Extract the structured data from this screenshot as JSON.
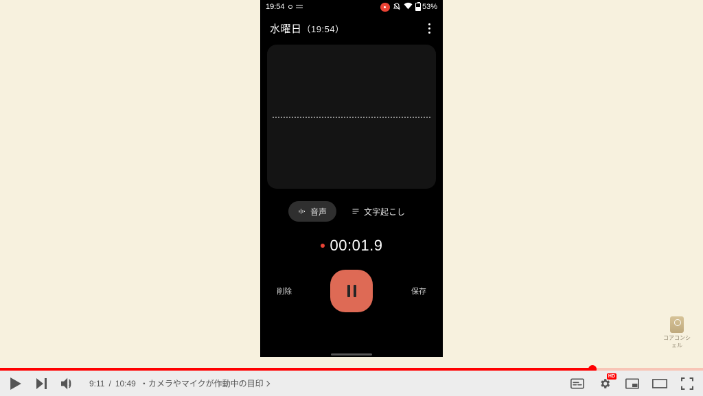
{
  "phone": {
    "status": {
      "time": "19:54",
      "battery_pct": "53%"
    },
    "header": {
      "title": "水曜日",
      "sub": "（19:54）"
    },
    "tabs": {
      "audio": "音声",
      "transcribe": "文字起こし"
    },
    "timer": "00:01.9",
    "controls": {
      "delete": "削除",
      "save": "保存"
    }
  },
  "watermark": {
    "label": "コアコンシェル"
  },
  "player": {
    "progress_pct": 84.3,
    "current": "9:11",
    "duration": "10:49",
    "chapter": "・カメラやマイクが作動中の目印",
    "hd_label": "HD"
  }
}
